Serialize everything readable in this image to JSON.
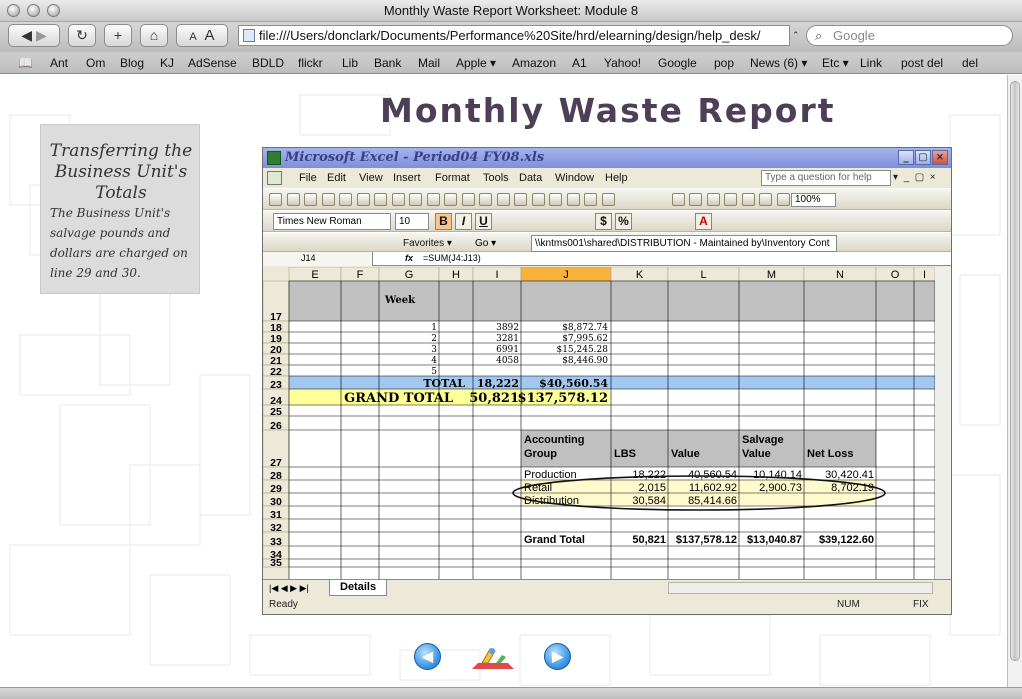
{
  "window": {
    "title": "Monthly Waste Report Worksheet: Module 8"
  },
  "toolbar": {
    "url": "file:///Users/donclark/Documents/Performance%20Site/hrd/elearning/design/help_desk/",
    "search_placeholder": "Google",
    "text_smaller": "A",
    "text_larger": "A"
  },
  "bookmarks": [
    "Ant",
    "Om",
    "Blog",
    "KJ",
    "AdSense",
    "BDLD",
    "flickr",
    "Lib",
    "Bank",
    "Mail",
    "Apple ▾",
    "Amazon",
    "A1",
    "Yahoo!",
    "Google",
    "pop",
    "News (6) ▾",
    "Etc ▾",
    "Link",
    "post del",
    "del"
  ],
  "page": {
    "title": "Monthly Waste Report",
    "sidebar_title": "Transferring the Business Unit's Totals",
    "sidebar_text": "The Business Unit's salvage pounds and dollars are charged on line 29 and 30."
  },
  "excel": {
    "title": "Microsoft Excel - Period04 FY08.xls",
    "menu": [
      "File",
      "Edit",
      "View",
      "Insert",
      "Format",
      "Tools",
      "Data",
      "Window",
      "Help"
    ],
    "help_placeholder": "Type a question for help",
    "zoom": "100%",
    "font_name": "Times New Roman",
    "font_size": "10",
    "favorites_label": "Favorites ▾",
    "go_label": "Go ▾",
    "path": "\\\\kntms001\\shared\\DISTRIBUTION - Maintained by\\Inventory Cont",
    "cell_ref": "J14",
    "fx": "fx",
    "formula": "=SUM(J4:J13)",
    "sheet_tab": "Details",
    "status_left": "Ready",
    "status_num": "NUM",
    "status_fix": "FIX",
    "columns": [
      "E",
      "F",
      "G",
      "H",
      "I",
      "J",
      "K",
      "L",
      "M",
      "N",
      "O",
      "I"
    ],
    "selected_column": "J",
    "rows": [
      "17",
      "18",
      "19",
      "20",
      "21",
      "22",
      "23",
      "24",
      "25",
      "26",
      "27",
      "28",
      "29",
      "30",
      "31",
      "32",
      "33",
      "34",
      "35"
    ],
    "week_header": "Week",
    "weeks": [
      {
        "row": "18",
        "week": "1",
        "lbs": "3892",
        "dollars": "$8,872.74"
      },
      {
        "row": "19",
        "week": "2",
        "lbs": "3281",
        "dollars": "$7,995.62"
      },
      {
        "row": "20",
        "week": "3",
        "lbs": "6991",
        "dollars": "$15,245.28"
      },
      {
        "row": "21",
        "week": "4",
        "lbs": "4058",
        "dollars": "$8,446.90"
      },
      {
        "row": "22",
        "week": "5",
        "lbs": "",
        "dollars": ""
      }
    ],
    "total": {
      "label": "TOTAL",
      "lbs": "18,222",
      "dollars": "$40,560.54"
    },
    "grand_total": {
      "label": "GRAND TOTAL",
      "lbs": "50,821",
      "dollars": "$137,578.12"
    },
    "summary_headers": [
      "Accounting Group",
      "LBS",
      "Value",
      "Salvage Value",
      "Net Loss"
    ],
    "summary_rows": [
      {
        "group": "Production",
        "lbs": "18,222",
        "value": "40,560.54",
        "salvage": "10,140.14",
        "net": "30,420.41"
      },
      {
        "group": "Retail",
        "lbs": "2,015",
        "value": "11,602.92",
        "salvage": "2,900.73",
        "net": "8,702.19"
      },
      {
        "group": "Distribution",
        "lbs": "30,584",
        "value": "85,414.66",
        "salvage": "",
        "net": ""
      }
    ],
    "summary_total": {
      "label": "Grand Total",
      "lbs": "50,821",
      "value": "$137,578.12",
      "salvage": "$13,040.87",
      "net": "$39,122.60"
    }
  },
  "colors": {
    "page_title": "#4d3f56",
    "total_row": "#a3c8f0",
    "grand_total_row": "#ffff99",
    "header_gray": "#c0c0c0",
    "highlight_fill": "#fffacd",
    "selected_col": "#f8b23c"
  },
  "nav": {
    "back_icon": "left-arrow-icon",
    "home_icon": "pencil-home-icon",
    "next_icon": "right-arrow-icon"
  }
}
